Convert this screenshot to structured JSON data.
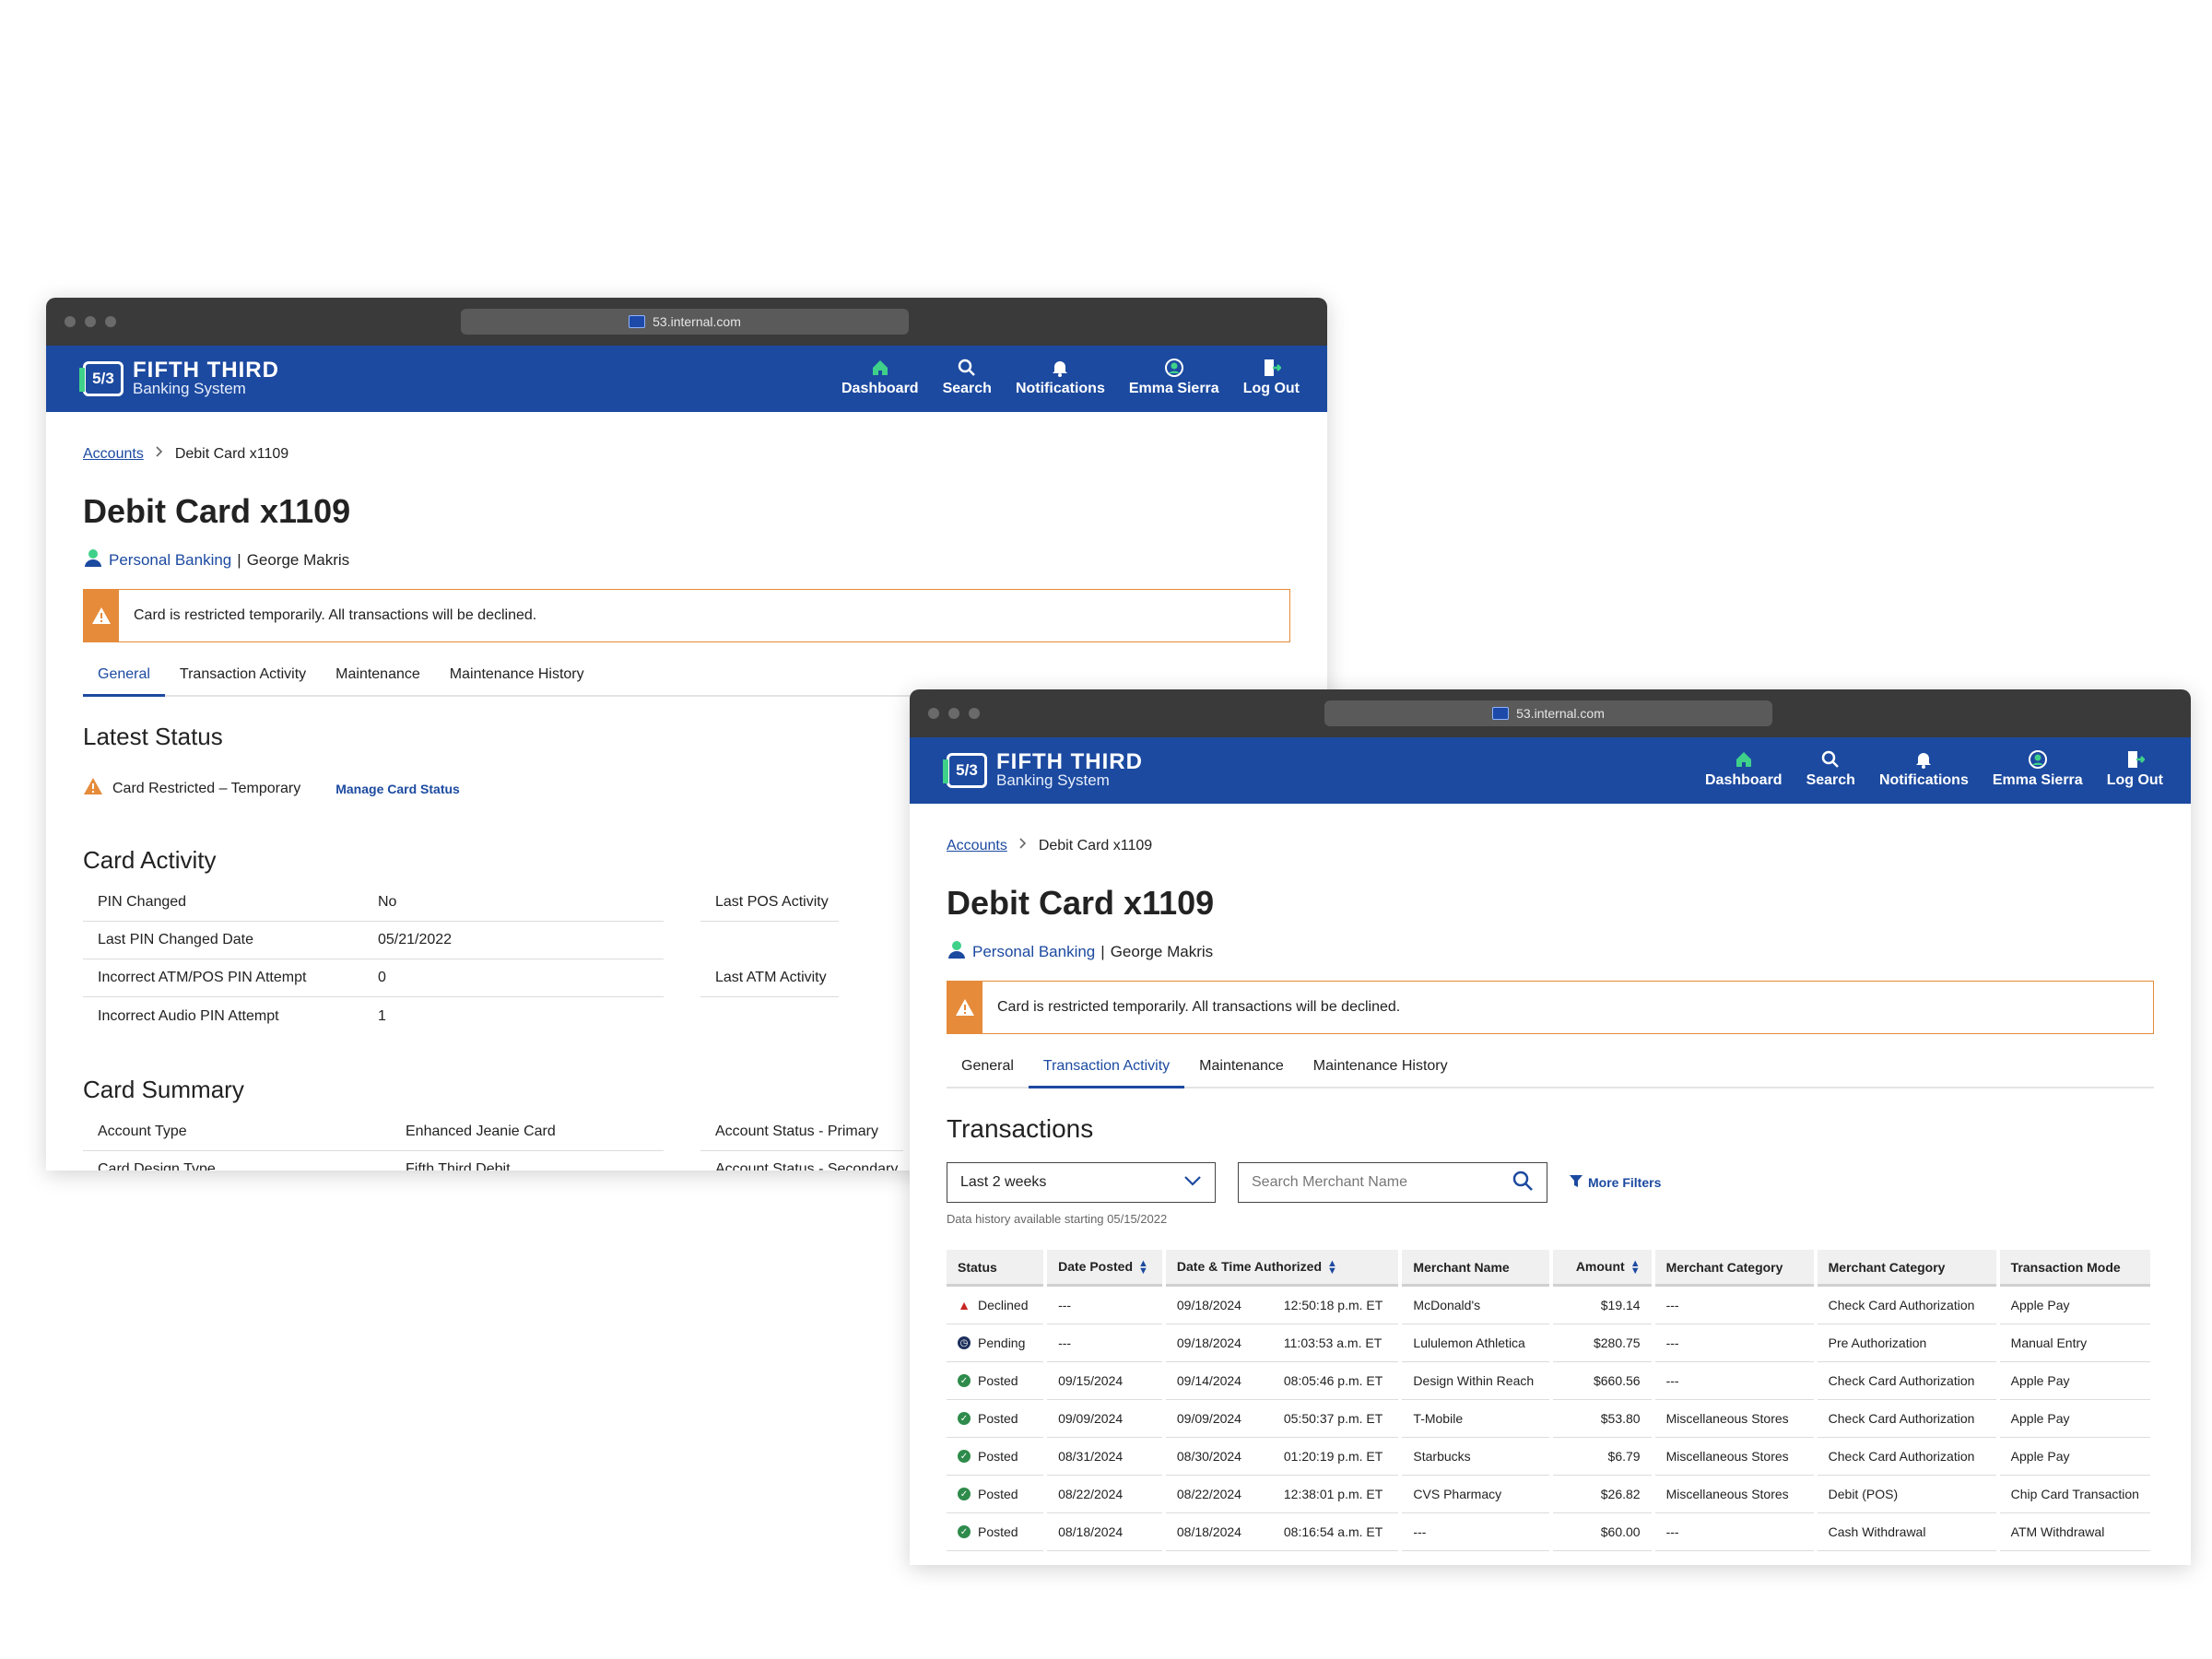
{
  "url": "53.internal.com",
  "brand": {
    "line1": "FIFTH THIRD",
    "line2": "Banking System",
    "mark": "5/3"
  },
  "nav": [
    {
      "label": "Dashboard",
      "icon": "house-icon"
    },
    {
      "label": "Search",
      "icon": "search-icon"
    },
    {
      "label": "Notifications",
      "icon": "bell-icon"
    },
    {
      "label": "Emma Sierra",
      "icon": "user-avatar-icon"
    },
    {
      "label": "Log Out",
      "icon": "logout-icon"
    }
  ],
  "breadcrumb": {
    "root": "Accounts",
    "current": "Debit Card x1109"
  },
  "page_title": "Debit Card x1109",
  "owner": {
    "segment": "Personal Banking",
    "separator": "|",
    "name": "George Makris"
  },
  "alert": "Card is restricted temporarily. All transactions will be declined.",
  "tabs": [
    "General",
    "Transaction Activity",
    "Maintenance",
    "Maintenance History"
  ],
  "general": {
    "latest_status_heading": "Latest Status",
    "status_text": "Card Restricted – Temporary",
    "manage_link": "Manage Card Status",
    "card_activity_heading": "Card Activity",
    "card_activity": [
      {
        "k": "PIN Changed",
        "v": "No"
      },
      {
        "k": "Last PIN Changed Date",
        "v": "05/21/2022"
      },
      {
        "k": "Incorrect ATM/POS PIN Attempt",
        "v": "0"
      },
      {
        "k": "Incorrect Audio PIN Attempt",
        "v": "1"
      }
    ],
    "card_activity_right": [
      "Last POS Activity",
      "Last ATM Activity"
    ],
    "card_summary_heading": "Card Summary",
    "card_summary": [
      {
        "k": "Account Type",
        "v": "Enhanced Jeanie Card"
      },
      {
        "k": "Card Design Type",
        "v": "Fifth Third Debit"
      }
    ],
    "card_summary_right": [
      "Account Status - Primary",
      "Account Status - Secondary"
    ]
  },
  "transactions": {
    "heading": "Transactions",
    "range": "Last 2 weeks",
    "search_placeholder": "Search Merchant Name",
    "more_filters": "More Filters",
    "history_note": "Data history available starting 05/15/2022",
    "columns": [
      "Status",
      "Date Posted",
      "Date & Time Authorized",
      "Merchant Name",
      "Amount",
      "Merchant Category",
      "Merchant Category",
      "Transaction Mode"
    ],
    "rows": [
      {
        "status": "Declined",
        "posted": "---",
        "auth_date": "09/18/2024",
        "auth_time": "12:50:18 p.m. ET",
        "merchant": "McDonald's",
        "amount": "$19.14",
        "cat1": "---",
        "cat2": "Check Card Authorization",
        "mode": "Apple Pay"
      },
      {
        "status": "Pending",
        "posted": "---",
        "auth_date": "09/18/2024",
        "auth_time": "11:03:53 a.m. ET",
        "merchant": "Lululemon Athletica",
        "amount": "$280.75",
        "cat1": "---",
        "cat2": "Pre Authorization",
        "mode": "Manual Entry"
      },
      {
        "status": "Posted",
        "posted": "09/15/2024",
        "auth_date": "09/14/2024",
        "auth_time": "08:05:46 p.m. ET",
        "merchant": "Design Within Reach",
        "amount": "$660.56",
        "cat1": "---",
        "cat2": "Check Card Authorization",
        "mode": "Apple Pay"
      },
      {
        "status": "Posted",
        "posted": "09/09/2024",
        "auth_date": "09/09/2024",
        "auth_time": "05:50:37 p.m. ET",
        "merchant": "T-Mobile",
        "amount": "$53.80",
        "cat1": "Miscellaneous Stores",
        "cat2": "Check Card Authorization",
        "mode": "Apple Pay"
      },
      {
        "status": "Posted",
        "posted": "08/31/2024",
        "auth_date": "08/30/2024",
        "auth_time": "01:20:19 p.m. ET",
        "merchant": "Starbucks",
        "amount": "$6.79",
        "cat1": "Miscellaneous Stores",
        "cat2": "Check Card Authorization",
        "mode": "Apple Pay"
      },
      {
        "status": "Posted",
        "posted": "08/22/2024",
        "auth_date": "08/22/2024",
        "auth_time": "12:38:01 p.m. ET",
        "merchant": "CVS Pharmacy",
        "amount": "$26.82",
        "cat1": "Miscellaneous Stores",
        "cat2": "Debit (POS)",
        "mode": "Chip Card Transaction"
      },
      {
        "status": "Posted",
        "posted": "08/18/2024",
        "auth_date": "08/18/2024",
        "auth_time": "08:16:54 a.m. ET",
        "merchant": "---",
        "amount": "$60.00",
        "cat1": "---",
        "cat2": "Cash Withdrawal",
        "mode": "ATM Withdrawal"
      }
    ]
  },
  "colors": {
    "brand_blue": "#1c4aa0",
    "accent_green": "#3fd18a",
    "warning_orange": "#e58b3a",
    "chrome": "#3a3a3a"
  }
}
